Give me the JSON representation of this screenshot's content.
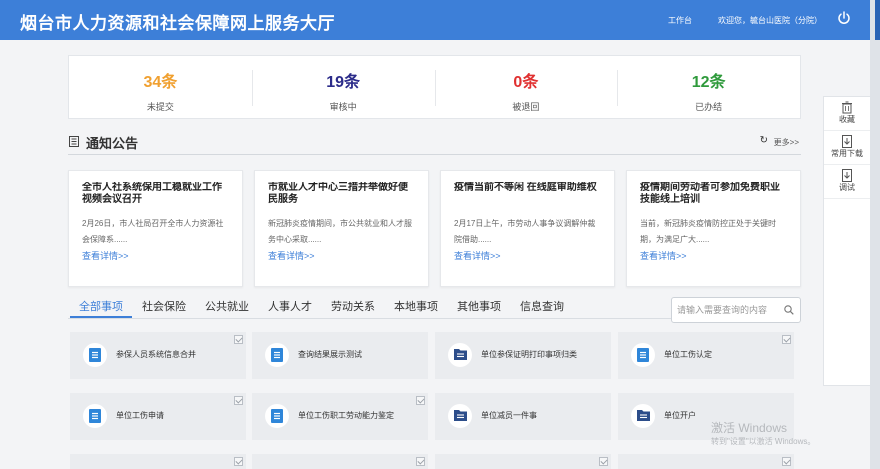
{
  "header": {
    "title": "烟台市人力资源和社会保障网上服务大厅",
    "workbench": "工作台",
    "welcome": "欢迎您，毓台山医院（分院）"
  },
  "stats": [
    {
      "value": "34条",
      "label": "未提交",
      "color": "#f0a030"
    },
    {
      "value": "19条",
      "label": "审核中",
      "color": "#2c2c8a"
    },
    {
      "value": "0条",
      "label": "被退回",
      "color": "#e03030"
    },
    {
      "value": "12条",
      "label": "已办结",
      "color": "#2f9a3c"
    }
  ],
  "notice": {
    "title": "通知公告",
    "more": "更多>>",
    "cards": [
      {
        "title": "全市人社系统保用工稳就业工作视频会议召开",
        "summary": "2月26日，市人社局召开全市人力资源社会保障系......",
        "link": "查看详情>>"
      },
      {
        "title": "市就业人才中心三措并举做好便民服务",
        "summary": "新冠肺炎疫情期间，市公共就业和人才服务中心采取......",
        "link": "查看详情>>"
      },
      {
        "title": "疫情当前不等闲 在线庭审助维权",
        "summary": "2月17日上午，市劳动人事争议调解仲裁院借助......",
        "link": "查看详情>>"
      },
      {
        "title": "疫情期间劳动者可参加免费职业技能线上培训",
        "summary": "当前，新冠肺炎疫情防控正处于关键时期，为满足广大......",
        "link": "查看详情>>"
      }
    ]
  },
  "side_tools": [
    {
      "label": "收藏",
      "icon": "trash-icon"
    },
    {
      "label": "常用下载",
      "icon": "download-icon"
    },
    {
      "label": "调试",
      "icon": "debug-icon"
    }
  ],
  "tabs": [
    "全部事项",
    "社会保险",
    "公共就业",
    "人事人才",
    "劳动关系",
    "本地事项",
    "其他事项",
    "信息查询"
  ],
  "search": {
    "placeholder": "请输入需要查询的内容"
  },
  "services": [
    {
      "label": "参保人员系统信息合并",
      "icon": "document-icon",
      "checked": true
    },
    {
      "label": "查询结果展示测试",
      "icon": "document-icon",
      "checked": false
    },
    {
      "label": "单位参保证明打印事项归类",
      "icon": "folder-icon",
      "checked": false
    },
    {
      "label": "单位工伤认定",
      "icon": "document-icon",
      "checked": true
    },
    {
      "label": "单位工伤申请",
      "icon": "document-icon",
      "checked": true
    },
    {
      "label": "单位工伤职工劳动能力鉴定",
      "icon": "document-icon",
      "checked": true
    },
    {
      "label": "单位减员一件事",
      "icon": "folder-icon",
      "checked": false
    },
    {
      "label": "单位开户",
      "icon": "folder-icon",
      "checked": false
    }
  ],
  "watermark": {
    "line1": "激活 Windows",
    "line2": "转到\"设置\"以激活 Windows。"
  },
  "colors": {
    "header": "#3d7fd8",
    "accent": "#3d7fd8",
    "tile_icon": "#2f86d9",
    "folder_icon": "#2c4d8a"
  }
}
